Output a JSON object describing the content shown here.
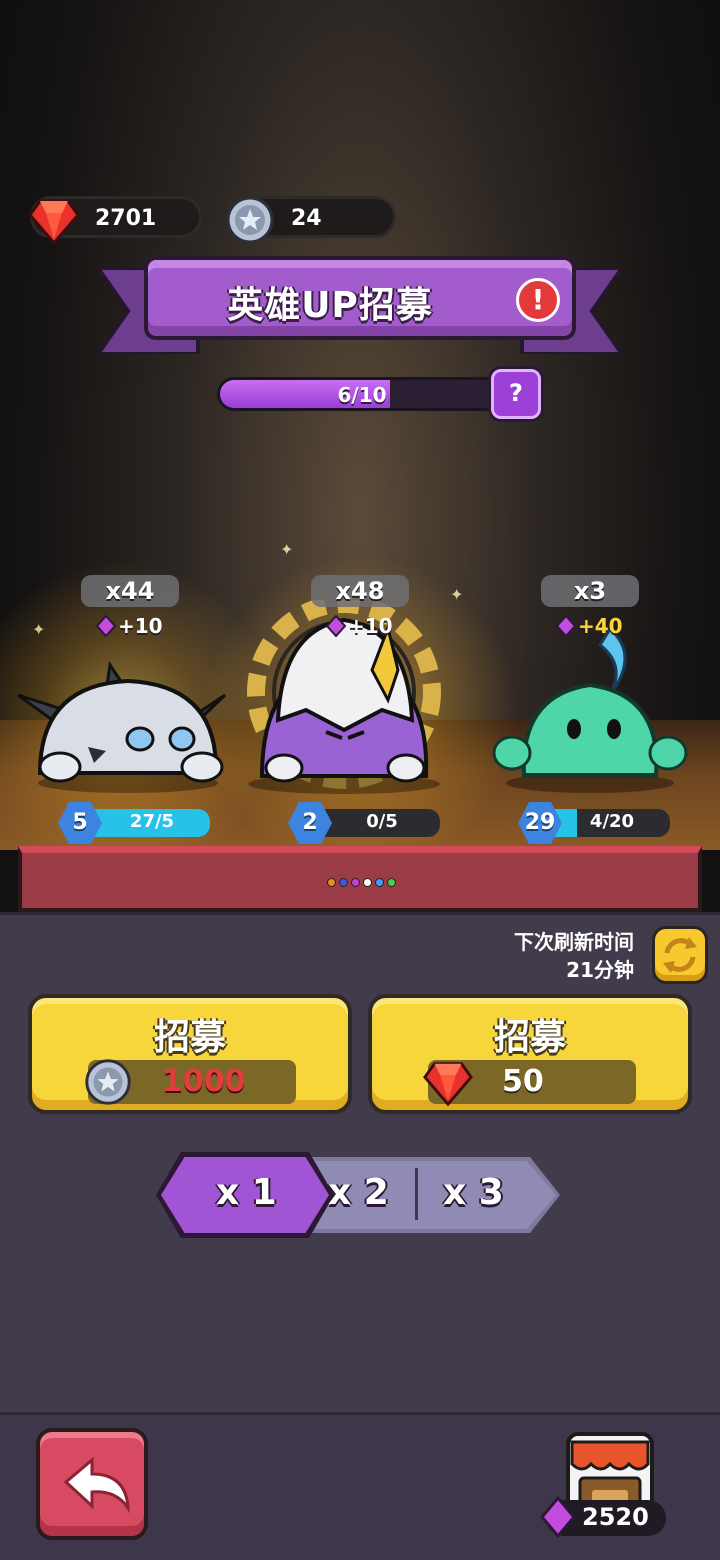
{
  "currencies": {
    "rubies": "2701",
    "coins": "24"
  },
  "banner": {
    "title": "英雄UP招募"
  },
  "progress": {
    "text": "6/10",
    "fraction": 0.6
  },
  "heroes": [
    {
      "count": "x44",
      "bonus": "+10",
      "level": "5",
      "exp_text": "27/5",
      "exp_fraction": 1.0
    },
    {
      "count": "x48",
      "bonus": "+10",
      "level": "2",
      "exp_text": "0/5",
      "exp_fraction": 0.0
    },
    {
      "count": "x3",
      "bonus": "+40",
      "level": "29",
      "exp_text": "4/20",
      "exp_fraction": 0.2
    }
  ],
  "stage_dots": [
    "#f08a24",
    "#3a57e8",
    "#c040e0",
    "#ffffff",
    "#3aa0ff",
    "#44d24a"
  ],
  "refresh": {
    "line1": "下次刷新时间",
    "line2": "21分钟"
  },
  "recruit_buttons": [
    {
      "label": "招募",
      "cost": "1000",
      "currency": "coin-icon"
    },
    {
      "label": "招募",
      "cost": "50",
      "currency": "ruby-icon"
    }
  ],
  "multiplier": {
    "options": [
      "x 1",
      "x 2",
      "x 3"
    ],
    "selected": "x 1"
  },
  "footer": {
    "shop_gems": "2520"
  },
  "colors": {
    "purple": "#a35ccc",
    "yellow": "#f6d63a",
    "red": "#d84a62",
    "panel": "#423b4b"
  }
}
